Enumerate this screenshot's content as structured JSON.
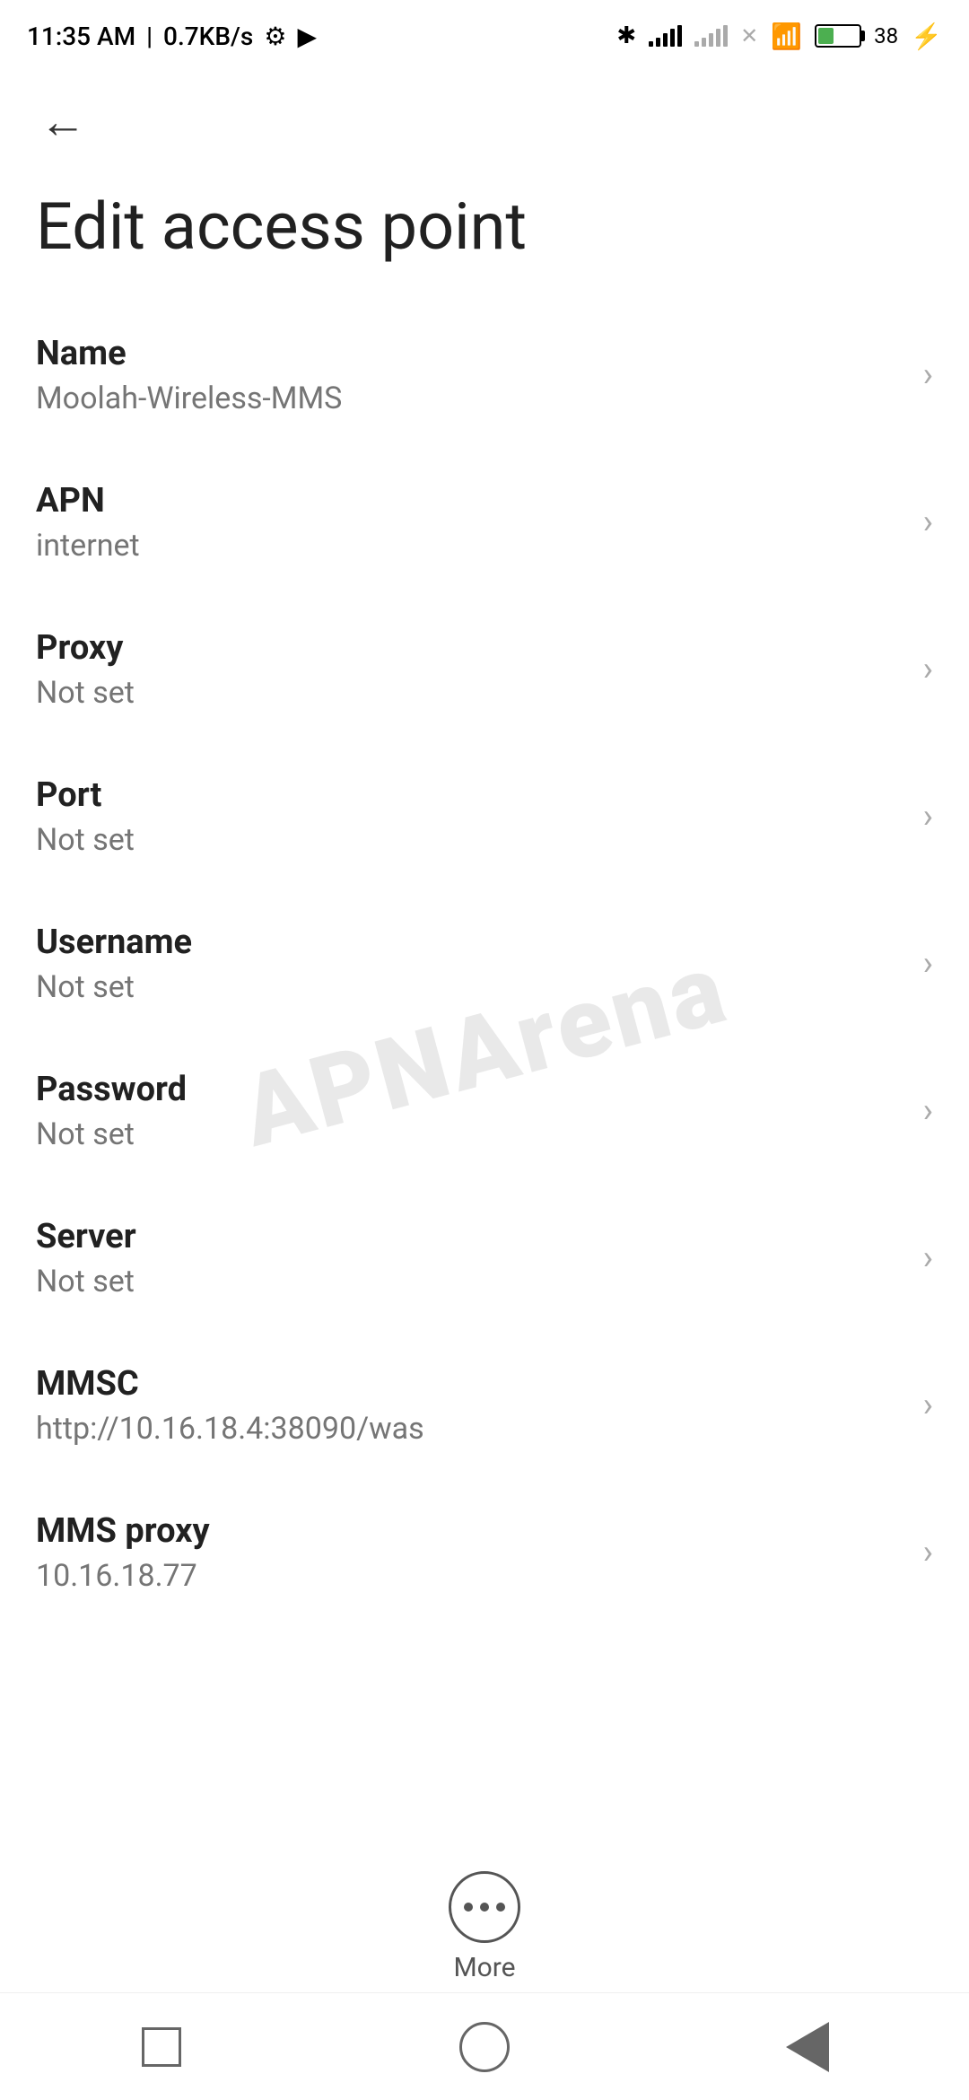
{
  "statusBar": {
    "time": "11:35 AM",
    "speed": "0.7KB/s"
  },
  "navigation": {
    "backLabel": "←"
  },
  "page": {
    "title": "Edit access point"
  },
  "settings": [
    {
      "id": "name",
      "label": "Name",
      "value": "Moolah-Wireless-MMS"
    },
    {
      "id": "apn",
      "label": "APN",
      "value": "internet"
    },
    {
      "id": "proxy",
      "label": "Proxy",
      "value": "Not set"
    },
    {
      "id": "port",
      "label": "Port",
      "value": "Not set"
    },
    {
      "id": "username",
      "label": "Username",
      "value": "Not set"
    },
    {
      "id": "password",
      "label": "Password",
      "value": "Not set"
    },
    {
      "id": "server",
      "label": "Server",
      "value": "Not set"
    },
    {
      "id": "mmsc",
      "label": "MMSC",
      "value": "http://10.16.18.4:38090/was"
    },
    {
      "id": "mms-proxy",
      "label": "MMS proxy",
      "value": "10.16.18.77"
    }
  ],
  "more": {
    "label": "More"
  },
  "watermark": {
    "text": "APNArena"
  }
}
